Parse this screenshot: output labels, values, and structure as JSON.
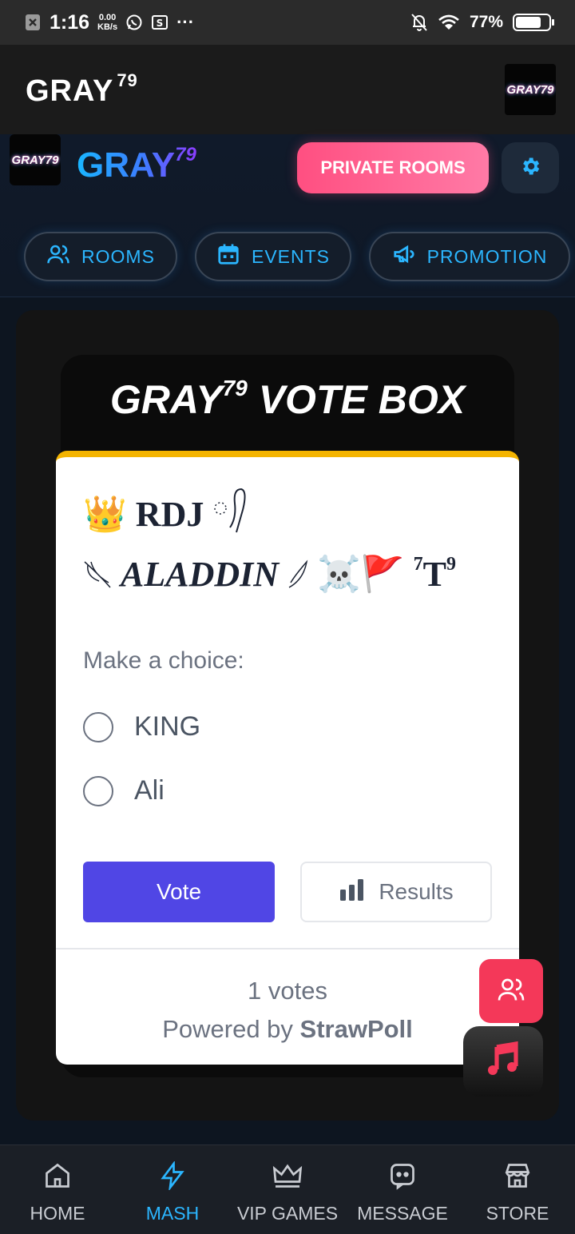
{
  "status_bar": {
    "time": "1:16",
    "net_speed_value": "0.00",
    "net_speed_unit": "KB/s",
    "more": "···",
    "battery": "77%",
    "battery_level": 0.77
  },
  "app_bar": {
    "title": "GRAY",
    "title_sup": "79",
    "logo_text": "GRAY79"
  },
  "header": {
    "brand": "GRAY",
    "brand_sup": "79",
    "logo_text": "GRAY79",
    "private_rooms_label": "PRIVATE ROOMS",
    "nav": [
      {
        "label": "ROOMS",
        "icon": "users-icon"
      },
      {
        "label": "EVENTS",
        "icon": "calendar-icon"
      },
      {
        "label": "PROMOTION",
        "icon": "megaphone-icon"
      }
    ]
  },
  "vote_box": {
    "title": "GRAY",
    "title_sup": "79",
    "title_rest": " VOTE BOX",
    "question_line1_emoji": "👑",
    "question_line1_text": "RDJ",
    "question_line2_text": "ALADDIN",
    "question_line2_emoji": "☠️🚩",
    "question_line2_sup": "7",
    "question_line2_tail": "T",
    "question_line2_tail_sup": "9",
    "prompt": "Make a choice:",
    "options": [
      "KING",
      "Ali"
    ],
    "vote_label": "Vote",
    "results_label": "Results",
    "votes_count": "1 votes",
    "powered_prefix": "Powered by ",
    "powered_brand": "StrawPoll"
  },
  "bottom_nav": [
    {
      "label": "HOME",
      "icon": "home-icon"
    },
    {
      "label": "MASH",
      "icon": "lightning-icon",
      "active": true
    },
    {
      "label": "VIP GAMES",
      "icon": "crown-icon"
    },
    {
      "label": "MESSAGE",
      "icon": "message-icon"
    },
    {
      "label": "STORE",
      "icon": "store-icon"
    }
  ],
  "colors": {
    "accent": "#2bb6ff",
    "private_rooms": "#ff4f81",
    "vote_button": "#5046e5",
    "card_top_border": "#f4b400",
    "fab_users": "#f43859"
  }
}
